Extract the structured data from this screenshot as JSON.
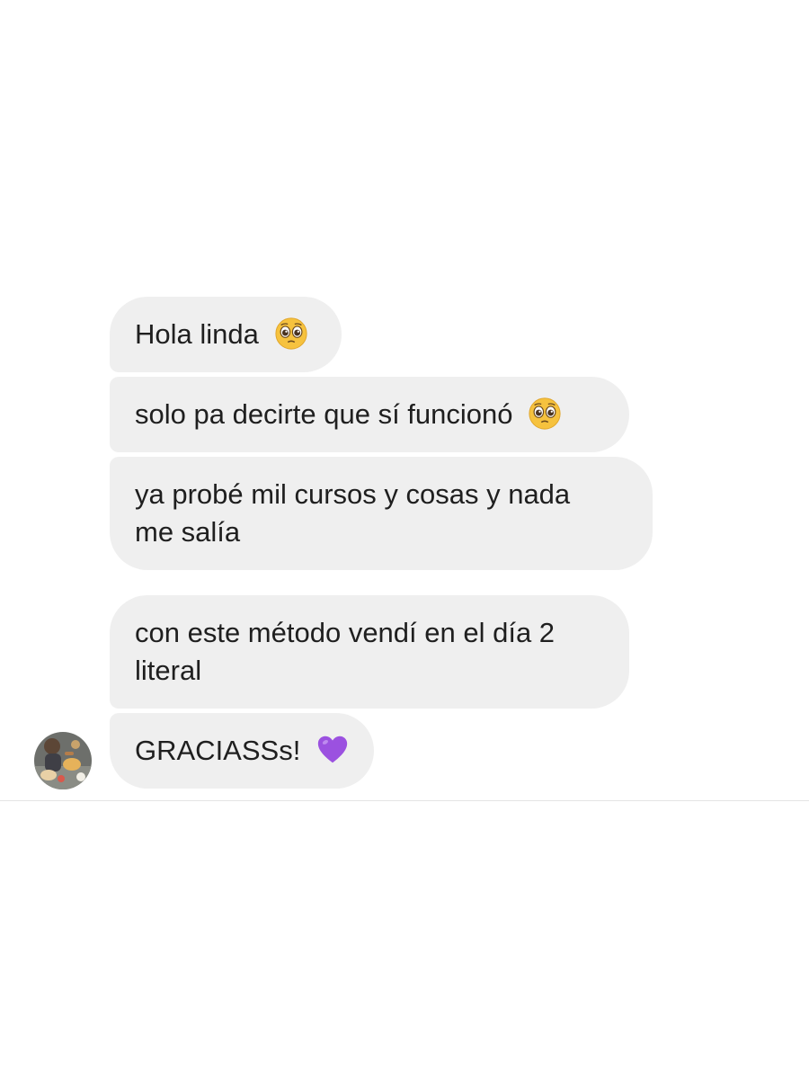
{
  "messages": [
    {
      "text": "Hola linda",
      "emoji": "pleading-face-icon"
    },
    {
      "text": "solo pa decirte que sí funcionó",
      "emoji": "pleading-face-icon"
    },
    {
      "lines": [
        "ya probé mil cursos y cosas y nada",
        "me salía"
      ]
    },
    {
      "lines": [
        "con este método vendí en el día 2",
        "literal"
      ]
    },
    {
      "text": "GRACIASSs!",
      "emoji": "purple-heart-icon"
    }
  ],
  "colors": {
    "bubble": "#efefef",
    "text": "#1f1f1f",
    "heart": "#9b51e0",
    "emoji_face": "#f6c23e"
  }
}
